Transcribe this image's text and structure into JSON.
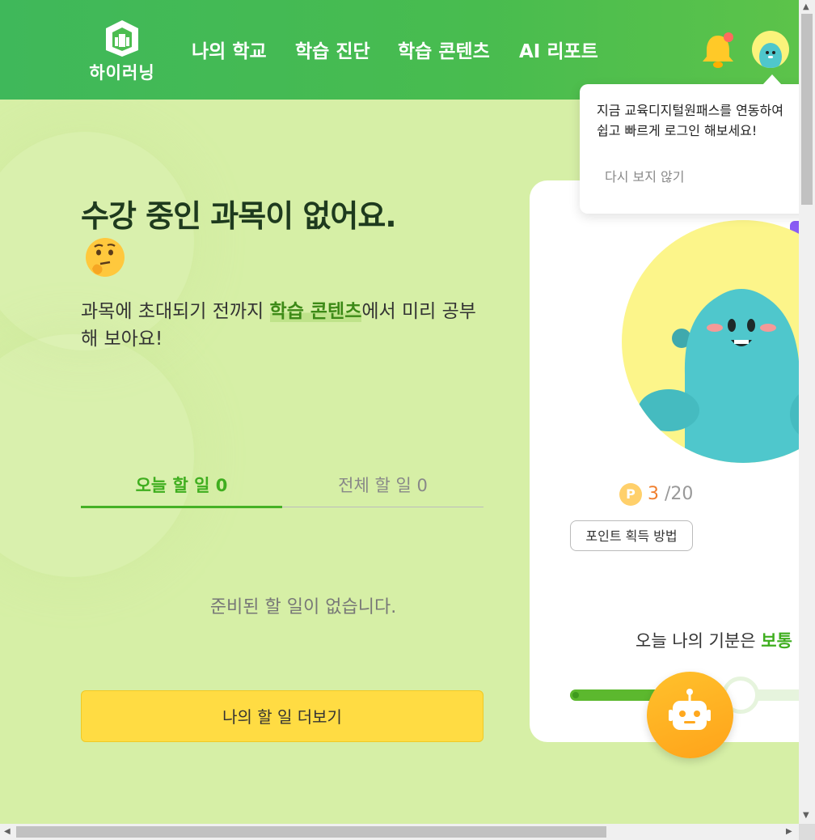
{
  "header": {
    "logo_text": "하이러닝",
    "nav": [
      "나의 학교",
      "학습 진단",
      "학습 콘텐츠",
      "AI 리포트"
    ]
  },
  "main": {
    "title": "수강 중인 과목이 없어요.",
    "subtitle_before": "과목에 초대되기 전까지 ",
    "subtitle_highlight": "학습 콘텐츠",
    "subtitle_after": "에서 미리 공부해 보아요!",
    "tabs": [
      {
        "label": "오늘 할 일 0",
        "active": true
      },
      {
        "label": "전체 할 일 0",
        "active": false
      }
    ],
    "empty_message": "준비된 할 일이 없습니다.",
    "more_button": "나의 할 일 더보기"
  },
  "card": {
    "coin_symbol": "P",
    "points_current": "3",
    "points_total": "/20",
    "point_button": "포인트 획득 방법",
    "mood_prefix": "오늘 나의 기분은 ",
    "mood_value": "보통",
    "mood_level": 0.7
  },
  "popup": {
    "line1": "지금 교육디지털원패스를 연동하여",
    "line2": "쉽고 빠르게 로그인 해보세요!",
    "dismiss": "다시 보지 않기"
  },
  "colors": {
    "header_green": "#48bc4f",
    "background": "#d6efa6",
    "accent_green": "#3fae1f",
    "button_yellow": "#ffdc43",
    "points_orange": "#f07f2e",
    "character_teal": "#4fc7cc"
  },
  "icons": [
    "logo-icon",
    "bell-icon",
    "avatar-icon",
    "thinking-face-emoji",
    "coin-icon",
    "chatbot-robot-icon"
  ]
}
